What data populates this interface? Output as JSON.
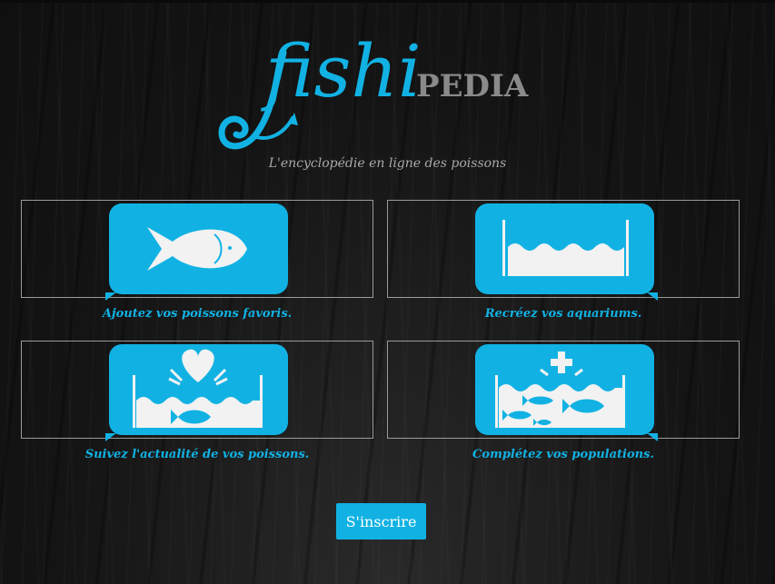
{
  "brand": {
    "logo_fish": "fishi",
    "logo_pedia": "PEDIA",
    "tagline": "L'encyclopédie en ligne des poissons",
    "accent_color": "#11b2e3"
  },
  "features": [
    {
      "caption": "Ajoutez vos poissons favoris.",
      "icon": "fish-icon"
    },
    {
      "caption": "Recréez vos aquariums.",
      "icon": "aquarium-icon"
    },
    {
      "caption": "Suivez l'actualité de vos poissons.",
      "icon": "heart-aquarium-icon"
    },
    {
      "caption": "Complétez vos populations.",
      "icon": "add-fish-aquarium-icon"
    }
  ],
  "signup_button": "S'inscrire"
}
